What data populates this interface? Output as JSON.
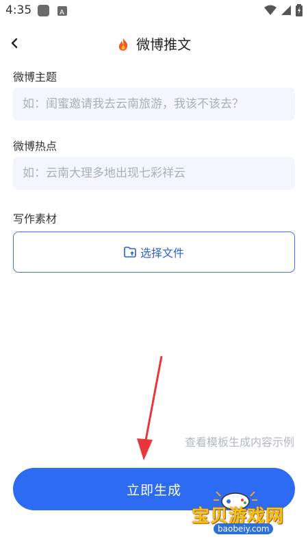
{
  "status_bar": {
    "time": "4:35",
    "icons": [
      "app-square-icon",
      "a-box-icon",
      "wifi-icon",
      "signal-icon",
      "battery-icon"
    ]
  },
  "header": {
    "title": "微博推文",
    "title_icon": "fire-icon",
    "back_icon": "chevron-left-icon"
  },
  "form": {
    "topic": {
      "label": "微博主题",
      "placeholder": "如：闺蜜邀请我去云南旅游，我该不该去？"
    },
    "hotspot": {
      "label": "微博热点",
      "placeholder": "如：云南大理多地出现七彩祥云"
    },
    "material": {
      "label": "写作素材",
      "button_label": "选择文件",
      "button_icon": "folder-upload-icon"
    }
  },
  "template_link": "查看模板生成内容示例",
  "generate_label": "立即生成",
  "watermark": {
    "text": "宝贝游戏网",
    "url": "baobeiy.com"
  },
  "colors": {
    "primary": "#2d6cf2",
    "input_bg": "#f3f6fc",
    "arrow": "#e5373c"
  }
}
